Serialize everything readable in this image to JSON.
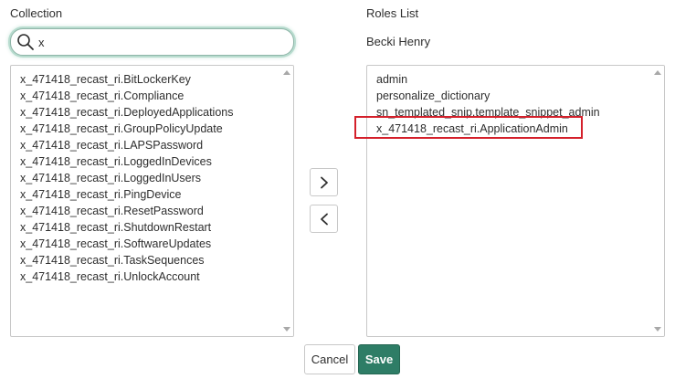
{
  "collection": {
    "label": "Collection",
    "search": {
      "value": "x"
    },
    "items": [
      "x_471418_recast_ri.BitLockerKey",
      "x_471418_recast_ri.Compliance",
      "x_471418_recast_ri.DeployedApplications",
      "x_471418_recast_ri.GroupPolicyUpdate",
      "x_471418_recast_ri.LAPSPassword",
      "x_471418_recast_ri.LoggedInDevices",
      "x_471418_recast_ri.LoggedInUsers",
      "x_471418_recast_ri.PingDevice",
      "x_471418_recast_ri.ResetPassword",
      "x_471418_recast_ri.ShutdownRestart",
      "x_471418_recast_ri.SoftwareUpdates",
      "x_471418_recast_ri.TaskSequences",
      "x_471418_recast_ri.UnlockAccount"
    ]
  },
  "roles": {
    "label": "Roles List",
    "user_name": "Becki Henry",
    "items": [
      "admin",
      "personalize_dictionary",
      "sn_templated_snip.template_snippet_admin",
      "x_471418_recast_ri.ApplicationAdmin"
    ]
  },
  "buttons": {
    "add_icon": "chevron-right-icon",
    "remove_icon": "chevron-left-icon",
    "cancel": "Cancel",
    "save": "Save"
  },
  "colors": {
    "save_bg": "#2e7d66",
    "highlight_border": "#d4202b",
    "search_glow": "#b8dccf"
  }
}
